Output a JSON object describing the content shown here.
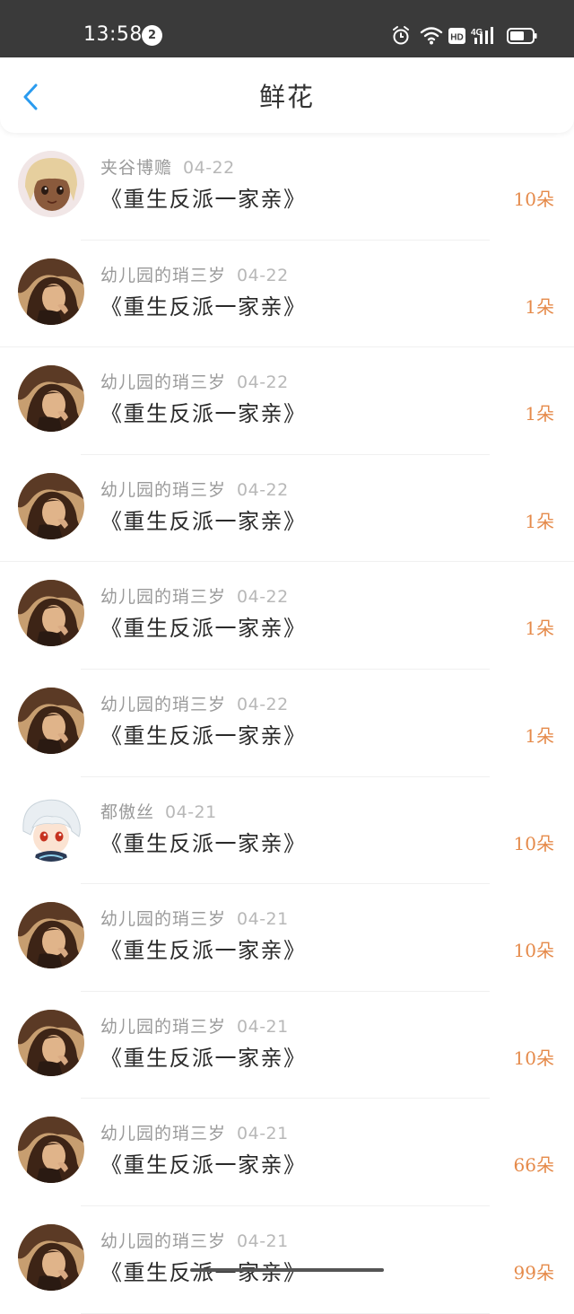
{
  "status_bar": {
    "time": "13:58",
    "notification_count": "2",
    "icons": [
      "alarm-icon",
      "wifi-icon",
      "hd-icon",
      "signal-4g-icon",
      "battery-icon"
    ],
    "hd_label": "HD",
    "network_label": "4G"
  },
  "header": {
    "back_icon": "chevron-left-icon",
    "title": "鲜花"
  },
  "colors": {
    "accent_back": "#2a9bef",
    "count_orange": "#e58a4a",
    "username_gray": "#9a9a9a",
    "date_gray": "#b8b8b8",
    "status_bar_bg": "#3a3a3a"
  },
  "records": [
    {
      "user": "夹谷博赡",
      "date": "04-22",
      "book": "《重生反派一家亲》",
      "count": "10朵",
      "avatar": "anime-tan-girl"
    },
    {
      "user": "幼儿园的琑三岁",
      "date": "04-22",
      "book": "《重生反派一家亲》",
      "count": "1朵",
      "avatar": "photo-woman"
    },
    {
      "user": "幼儿园的琑三岁",
      "date": "04-22",
      "book": "《重生反派一家亲》",
      "count": "1朵",
      "avatar": "photo-woman"
    },
    {
      "user": "幼儿园的琑三岁",
      "date": "04-22",
      "book": "《重生反派一家亲》",
      "count": "1朵",
      "avatar": "photo-woman"
    },
    {
      "user": "幼儿园的琑三岁",
      "date": "04-22",
      "book": "《重生反派一家亲》",
      "count": "1朵",
      "avatar": "photo-woman"
    },
    {
      "user": "幼儿园的琑三岁",
      "date": "04-22",
      "book": "《重生反派一家亲》",
      "count": "1朵",
      "avatar": "photo-woman"
    },
    {
      "user": "都傲丝",
      "date": "04-21",
      "book": "《重生反派一家亲》",
      "count": "10朵",
      "avatar": "anime-white-hair"
    },
    {
      "user": "幼儿园的琑三岁",
      "date": "04-21",
      "book": "《重生反派一家亲》",
      "count": "10朵",
      "avatar": "photo-woman"
    },
    {
      "user": "幼儿园的琑三岁",
      "date": "04-21",
      "book": "《重生反派一家亲》",
      "count": "10朵",
      "avatar": "photo-woman"
    },
    {
      "user": "幼儿园的琑三岁",
      "date": "04-21",
      "book": "《重生反派一家亲》",
      "count": "66朵",
      "avatar": "photo-woman"
    },
    {
      "user": "幼儿园的琑三岁",
      "date": "04-21",
      "book": "《重生反派一家亲》",
      "count": "99朵",
      "avatar": "photo-woman"
    }
  ]
}
